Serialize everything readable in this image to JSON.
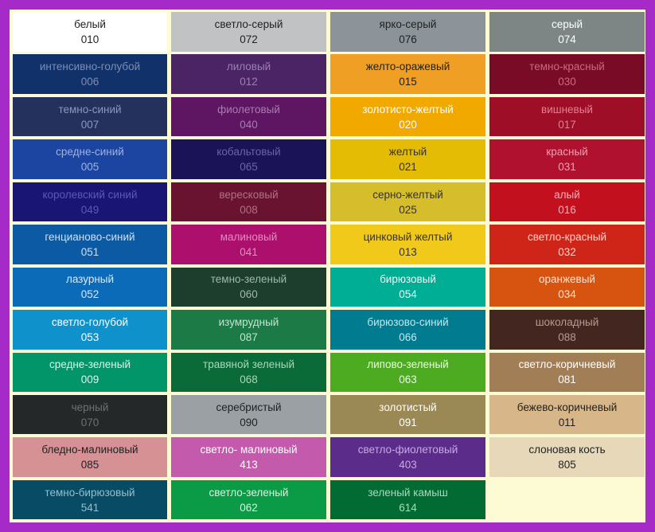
{
  "swatches": [
    {
      "name": "белый",
      "code": "010",
      "bg": "#ffffff",
      "fg": "#222222"
    },
    {
      "name": "светло-серый",
      "code": "072",
      "bg": "#c0c2c3",
      "fg": "#222222"
    },
    {
      "name": "ярко-серый",
      "code": "076",
      "bg": "#8c9499",
      "fg": "#222222"
    },
    {
      "name": "серый",
      "code": "074",
      "bg": "#7e8685",
      "fg": "#ffffff"
    },
    {
      "name": "интенсивно-голубой",
      "code": "006",
      "bg": "#11316b",
      "fg": "#7d8db5"
    },
    {
      "name": "лиловый",
      "code": "012",
      "bg": "#4a2465",
      "fg": "#9a80b4"
    },
    {
      "name": "желто-оражевый",
      "code": "015",
      "bg": "#ee9f24",
      "fg": "#222222"
    },
    {
      "name": "темно-красный",
      "code": "030",
      "bg": "#7a0b26",
      "fg": "#c86a82"
    },
    {
      "name": "темно-синий",
      "code": "007",
      "bg": "#24315d",
      "fg": "#8c98bb"
    },
    {
      "name": "фиолетовый",
      "code": "040",
      "bg": "#5e1662",
      "fg": "#a97cb0"
    },
    {
      "name": "золотисто-желтый",
      "code": "020",
      "bg": "#f1a900",
      "fg": "#ffffff"
    },
    {
      "name": "вишневый",
      "code": "017",
      "bg": "#9e0f27",
      "fg": "#e08094"
    },
    {
      "name": "средне-синий",
      "code": "005",
      "bg": "#1b45a1",
      "fg": "#9db3e2"
    },
    {
      "name": "кобальтовый",
      "code": "065",
      "bg": "#1a1358",
      "fg": "#6c62a8"
    },
    {
      "name": "желтый",
      "code": "021",
      "bg": "#e4bc04",
      "fg": "#333333"
    },
    {
      "name": "красный",
      "code": "031",
      "bg": "#b0112e",
      "fg": "#f0a0b0"
    },
    {
      "name": "королевский синий",
      "code": "049",
      "bg": "#191575",
      "fg": "#5d58b4"
    },
    {
      "name": "вересковый",
      "code": "008",
      "bg": "#6a1331",
      "fg": "#b07088"
    },
    {
      "name": "серно-желтый",
      "code": "025",
      "bg": "#d6bd2b",
      "fg": "#333333"
    },
    {
      "name": "алый",
      "code": "016",
      "bg": "#c3101f",
      "fg": "#f7b0b8"
    },
    {
      "name": "генцианово-синий",
      "code": "051",
      "bg": "#0b5aa3",
      "fg": "#cfe0f2"
    },
    {
      "name": "малиновый",
      "code": "041",
      "bg": "#ad0f6d",
      "fg": "#e48cc0"
    },
    {
      "name": "цинковый желтый",
      "code": "013",
      "bg": "#f1c91b",
      "fg": "#333333"
    },
    {
      "name": "светло-красный",
      "code": "032",
      "bg": "#cf2418",
      "fg": "#fdd0c8"
    },
    {
      "name": "лазурный",
      "code": "052",
      "bg": "#0c6bb9",
      "fg": "#d6e8f7"
    },
    {
      "name": "темно-зеленый",
      "code": "060",
      "bg": "#1e3e2d",
      "fg": "#a0b8aa"
    },
    {
      "name": "бирюзовый",
      "code": "054",
      "bg": "#00ad95",
      "fg": "#e6fbf6"
    },
    {
      "name": "оранжевый",
      "code": "034",
      "bg": "#d65410",
      "fg": "#fde0d0"
    },
    {
      "name": "светло-голубой",
      "code": "053",
      "bg": "#0f91cc",
      "fg": "#ffffff"
    },
    {
      "name": "изумрудный",
      "code": "087",
      "bg": "#1b7a45",
      "fg": "#bfe6cf"
    },
    {
      "name": "бирюзово-синий",
      "code": "066",
      "bg": "#007b8f",
      "fg": "#bfe8ee"
    },
    {
      "name": "шоколадный",
      "code": "088",
      "bg": "#43261f",
      "fg": "#b89a90"
    },
    {
      "name": "средне-зеленый",
      "code": "009",
      "bg": "#03956a",
      "fg": "#d8f5ea"
    },
    {
      "name": "травяной зеленый",
      "code": "068",
      "bg": "#0a6a38",
      "fg": "#a8d8bb"
    },
    {
      "name": "липово-зеленый",
      "code": "063",
      "bg": "#4cab20",
      "fg": "#ecfbe0"
    },
    {
      "name": "светло-коричневый",
      "code": "081",
      "bg": "#a27e57",
      "fg": "#ffffff"
    },
    {
      "name": "черный",
      "code": "070",
      "bg": "#252828",
      "fg": "#6c7272"
    },
    {
      "name": "серебристый",
      "code": "090",
      "bg": "#9aa0a3",
      "fg": "#222222"
    },
    {
      "name": "золотистый",
      "code": "091",
      "bg": "#9a8954",
      "fg": "#ffffff"
    },
    {
      "name": "бежево-коричневый",
      "code": "011",
      "bg": "#d7b689",
      "fg": "#222222"
    },
    {
      "name": "бледно-малиновый",
      "code": "085",
      "bg": "#d59193",
      "fg": "#222222"
    },
    {
      "name": "светло- малиновый",
      "code": "413",
      "bg": "#c35aab",
      "fg": "#ffffff"
    },
    {
      "name": "светло-фиолетовый",
      "code": "403",
      "bg": "#5b2c89",
      "fg": "#c6a8e4"
    },
    {
      "name": "слоновая кость",
      "code": "805",
      "bg": "#e6d8b8",
      "fg": "#222222"
    },
    {
      "name": "темно-бирюзовый",
      "code": "541",
      "bg": "#074b64",
      "fg": "#94bfd0"
    },
    {
      "name": "светло-зеленый",
      "code": "062",
      "bg": "#0b9b46",
      "fg": "#d6f5e0"
    },
    {
      "name": "зеленый камыш",
      "code": "614",
      "bg": "#026b33",
      "fg": "#a6dbbc"
    }
  ],
  "colors": {
    "outer_border": "#a52ac8",
    "panel_background": "#fdfbd3"
  }
}
